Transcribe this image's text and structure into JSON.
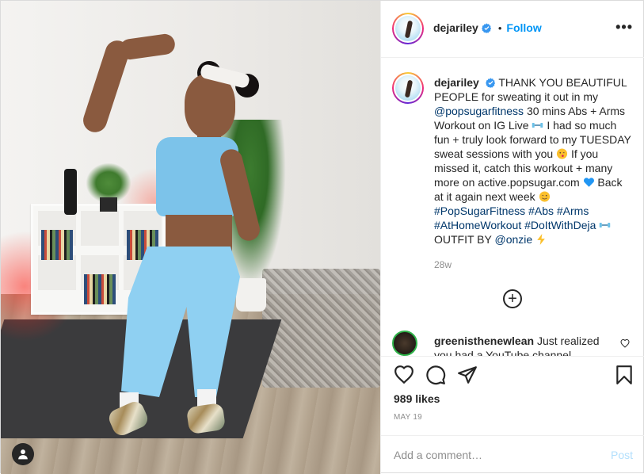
{
  "post": {
    "username": "dejariley",
    "follow_label": "Follow",
    "separator": "•",
    "more_label": "•••",
    "photo_alt": "Woman flexing in light blue workout set"
  },
  "caption": {
    "username": "dejariley",
    "parts": {
      "p1": "THANK YOU BEAUTIFUL PEOPLE for sweating it out in my ",
      "tag_popsugar": "@popsugarfitness",
      "p2": " 30 mins Abs + Arms Workout on IG Live ",
      "p3": " I had so much fun + truly look forward to my TUESDAY sweat sessions with you ",
      "p4": " If you missed it, catch this workout + many more on active.popsugar.com ",
      "p5": " Back at it again next week ",
      "h1": "#PopSugarFitness",
      "h2": "#Abs",
      "h3": "#Arms",
      "h4": "#AtHomeWorkout",
      "h5": "#DoItWithDeja",
      "p6": " OUTFIT BY ",
      "tag_onzie": "@onzie"
    },
    "time": "28w"
  },
  "comments": [
    {
      "username": "greenisthenewlean",
      "text": "Just realized",
      "text_cut": "you had a YouTube channel."
    }
  ],
  "actions": {
    "likes": "989 likes",
    "date": "MAY 19"
  },
  "composer": {
    "placeholder": "Add a comment…",
    "post_label": "Post"
  },
  "icons": {
    "verified": "verified-badge-icon",
    "more": "more-options-icon",
    "like": "heart-icon",
    "comment": "comment-icon",
    "share": "paper-plane-icon",
    "save": "bookmark-icon",
    "load_more": "plus-circle-icon",
    "user_tag": "person-icon"
  },
  "colors": {
    "link": "#0095f6",
    "tag": "#00376b",
    "muted": "#8e8e8e",
    "border": "#efefef",
    "post_disabled": "#b2dffc"
  }
}
